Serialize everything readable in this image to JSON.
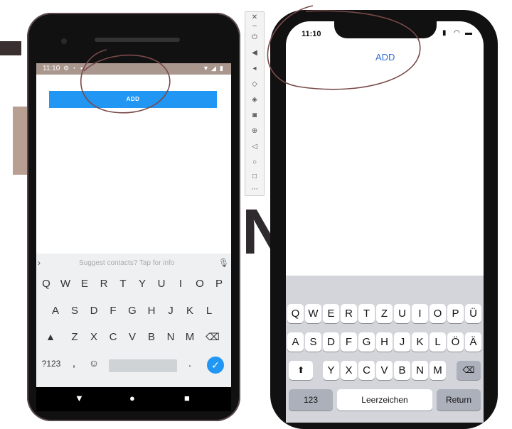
{
  "android": {
    "status_time": "11:10",
    "add_button": "ADD",
    "suggestion_text": "Suggest contacts? Tap for info",
    "keyboard": {
      "row1": [
        "Q",
        "W",
        "E",
        "R",
        "T",
        "Y",
        "U",
        "I",
        "O",
        "P"
      ],
      "row2": [
        "A",
        "S",
        "D",
        "F",
        "G",
        "H",
        "J",
        "K",
        "L"
      ],
      "row3": [
        "Z",
        "X",
        "C",
        "V",
        "B",
        "N",
        "M"
      ],
      "symbols_key": "?123",
      "comma_key": ",",
      "period_key": "."
    }
  },
  "iphone": {
    "status_time": "11:10",
    "add_button": "ADD",
    "keyboard": {
      "row1": [
        "Q",
        "W",
        "E",
        "R",
        "T",
        "Z",
        "U",
        "I",
        "O",
        "P",
        "Ü"
      ],
      "row2": [
        "A",
        "S",
        "D",
        "F",
        "G",
        "H",
        "J",
        "K",
        "L",
        "Ö",
        "Ä"
      ],
      "row3": [
        "Y",
        "X",
        "C",
        "V",
        "B",
        "N",
        "M"
      ],
      "numbers_key": "123",
      "space_key": "Leerzeichen",
      "return_key": "Return"
    }
  },
  "colors": {
    "android_accent": "#2196f3",
    "android_status": "#a9968d",
    "ios_link": "#2f6fd6",
    "annotation": "#7a4a4a"
  }
}
